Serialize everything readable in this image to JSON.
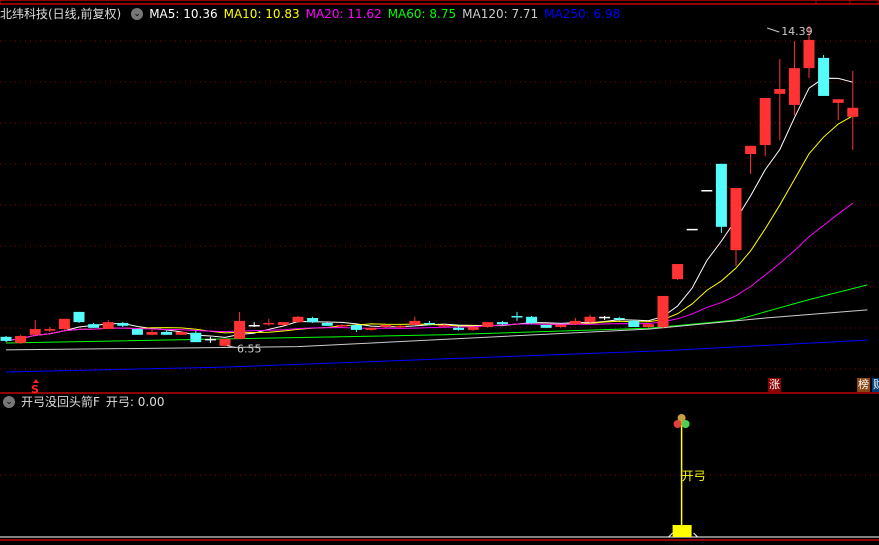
{
  "header": {
    "title": "北纬科技(日线,前复权)",
    "ma": [
      {
        "label": "MA5: 10.36",
        "color": "#ffffff"
      },
      {
        "label": "MA10: 10.83",
        "color": "#ffff00"
      },
      {
        "label": "MA20: 11.62",
        "color": "#ff00ff"
      },
      {
        "label": "MA60: 8.75",
        "color": "#00ff00"
      },
      {
        "label": "MA120: 7.71",
        "color": "#cccccc"
      },
      {
        "label": "MA250: 6.98",
        "color": "#0000ff"
      }
    ]
  },
  "indicator": {
    "title": "开弓没回头箭F",
    "value_label": "开弓: 0.00",
    "signal_label": "开弓",
    "signal_index": 46
  },
  "markers": {
    "s": "S",
    "zhang": "涨",
    "bang": "榜",
    "cai": "财"
  },
  "colors": {
    "up": "#ff3333",
    "down": "#54fcfc",
    "grid": "#8b0000",
    "border": "#c00000"
  },
  "chart_data": {
    "type": "candlestick",
    "title": "北纬科技(日线,前复权)",
    "ylim": [
      5.8,
      14.8
    ],
    "annotations": [
      {
        "label": "14.39",
        "index": 52,
        "price": 14.39
      },
      {
        "label": "6.55",
        "index": 15,
        "price": 6.55
      }
    ],
    "ohlc": [
      [
        6.79,
        6.81,
        6.66,
        6.69
      ],
      [
        6.64,
        6.84,
        6.62,
        6.81
      ],
      [
        6.84,
        7.2,
        6.84,
        6.98
      ],
      [
        6.94,
        7.03,
        6.91,
        6.98
      ],
      [
        6.98,
        7.23,
        6.96,
        7.23
      ],
      [
        7.4,
        7.4,
        7.13,
        7.15
      ],
      [
        7.1,
        7.13,
        7.01,
        7.01
      ],
      [
        6.98,
        7.2,
        6.98,
        7.15
      ],
      [
        7.13,
        7.15,
        7.03,
        7.06
      ],
      [
        6.98,
        6.98,
        6.84,
        6.84
      ],
      [
        6.84,
        6.96,
        6.84,
        6.91
      ],
      [
        6.91,
        6.94,
        6.84,
        6.84
      ],
      [
        6.84,
        6.94,
        6.84,
        6.91
      ],
      [
        6.89,
        6.94,
        6.66,
        6.66
      ],
      [
        6.74,
        6.79,
        6.64,
        6.74
      ],
      [
        6.57,
        6.74,
        6.55,
        6.74
      ],
      [
        6.74,
        7.4,
        6.74,
        7.18
      ],
      [
        7.08,
        7.15,
        7.03,
        7.08
      ],
      [
        7.1,
        7.23,
        7.06,
        7.13
      ],
      [
        7.08,
        7.15,
        7.06,
        7.15
      ],
      [
        7.15,
        7.3,
        7.13,
        7.28
      ],
      [
        7.25,
        7.28,
        7.13,
        7.15
      ],
      [
        7.13,
        7.15,
        7.06,
        7.06
      ],
      [
        7.06,
        7.1,
        7.03,
        7.08
      ],
      [
        7.08,
        7.08,
        6.91,
        6.96
      ],
      [
        6.96,
        7.01,
        6.94,
        7.01
      ],
      [
        7.03,
        7.08,
        7.01,
        7.08
      ],
      [
        7.03,
        7.08,
        7.01,
        7.06
      ],
      [
        7.08,
        7.28,
        7.08,
        7.18
      ],
      [
        7.13,
        7.18,
        7.08,
        7.1
      ],
      [
        7.06,
        7.1,
        7.03,
        7.08
      ],
      [
        7.01,
        7.06,
        6.94,
        6.96
      ],
      [
        6.96,
        7.03,
        6.94,
        7.03
      ],
      [
        7.03,
        7.15,
        7.01,
        7.15
      ],
      [
        7.15,
        7.18,
        7.08,
        7.1
      ],
      [
        7.3,
        7.4,
        7.18,
        7.28
      ],
      [
        7.28,
        7.3,
        7.1,
        7.13
      ],
      [
        7.08,
        7.08,
        7.01,
        7.01
      ],
      [
        7.03,
        7.08,
        7.01,
        7.08
      ],
      [
        7.1,
        7.25,
        7.08,
        7.18
      ],
      [
        7.15,
        7.33,
        7.13,
        7.28
      ],
      [
        7.28,
        7.3,
        7.2,
        7.28
      ],
      [
        7.25,
        7.28,
        7.18,
        7.23
      ],
      [
        7.18,
        7.2,
        7.03,
        7.03
      ],
      [
        7.03,
        7.1,
        7.01,
        7.1
      ],
      [
        7.03,
        7.79,
        7.0,
        7.79
      ],
      [
        8.2,
        8.57,
        8.18,
        8.57
      ],
      [
        9.43,
        9.43,
        9.43,
        9.43
      ],
      [
        10.38,
        10.38,
        10.38,
        10.38
      ],
      [
        11.02,
        11.02,
        9.33,
        9.48
      ],
      [
        8.91,
        10.43,
        8.52,
        10.43
      ],
      [
        11.26,
        11.46,
        10.77,
        11.46
      ],
      [
        11.48,
        12.63,
        11.21,
        12.63
      ],
      [
        12.73,
        13.58,
        11.6,
        12.85
      ],
      [
        12.46,
        14.02,
        12.21,
        13.36
      ],
      [
        13.36,
        14.39,
        13.12,
        14.05
      ],
      [
        13.61,
        13.68,
        12.68,
        12.68
      ],
      [
        12.51,
        12.6,
        12.09,
        12.6
      ],
      [
        12.17,
        13.29,
        11.36,
        12.39
      ]
    ],
    "long_ma": [
      {
        "name": "MA60",
        "color": "#00ff00",
        "points": [
          [
            0,
            6.64
          ],
          [
            30,
            6.84
          ],
          [
            44,
            7.0
          ],
          [
            50,
            7.2
          ],
          [
            55,
            7.7
          ],
          [
            59,
            8.06
          ]
        ]
      },
      {
        "name": "MA120",
        "color": "#cccccc",
        "points": [
          [
            0,
            6.47
          ],
          [
            20,
            6.55
          ],
          [
            44,
            6.98
          ],
          [
            52,
            7.25
          ],
          [
            59,
            7.45
          ]
        ]
      },
      {
        "name": "MA250",
        "color": "#0000ff",
        "points": [
          [
            0,
            5.93
          ],
          [
            15,
            6.05
          ],
          [
            30,
            6.25
          ],
          [
            45,
            6.45
          ],
          [
            59,
            6.71
          ]
        ]
      }
    ]
  }
}
